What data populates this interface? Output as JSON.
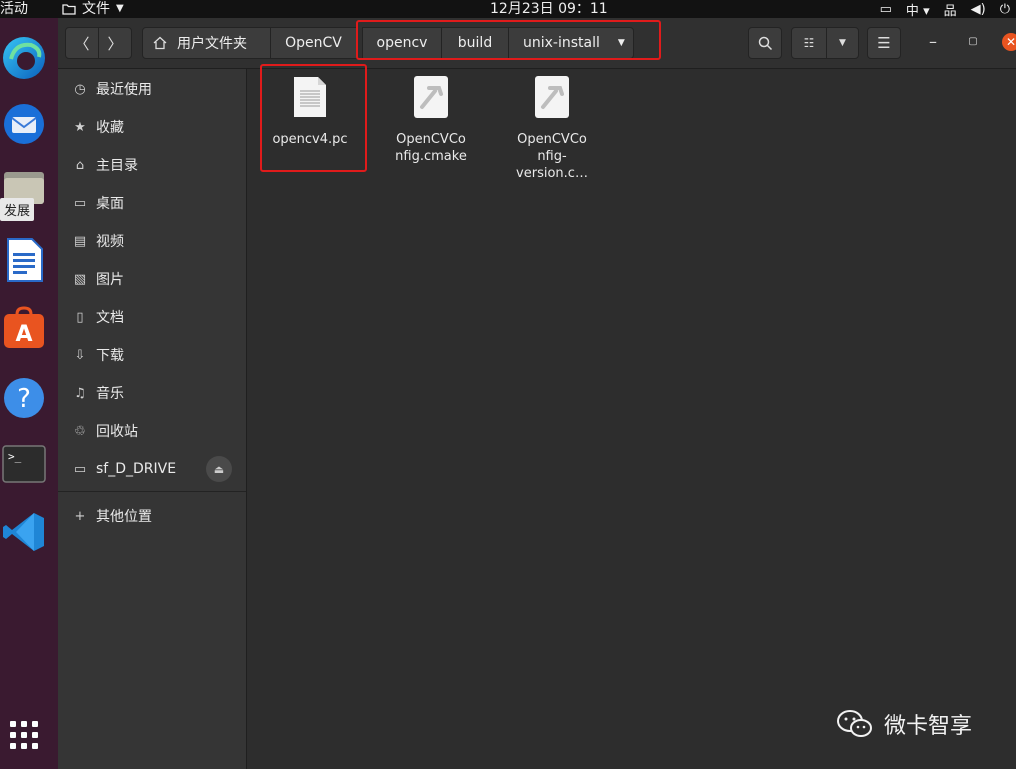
{
  "topbar": {
    "activities": "活动",
    "app_menu": "文件",
    "clock": "12月23日  09：11",
    "input_method": "中"
  },
  "dock": {
    "tooltip": "发展",
    "apps": [
      "edge-icon",
      "thunderbird-icon",
      "files-icon",
      "writer-icon",
      "software-icon",
      "help-icon",
      "terminal-icon",
      "vscode-icon",
      "show-apps-icon"
    ]
  },
  "header": {
    "home_crumb": "用户文件夹",
    "crumbs": [
      "OpenCV",
      "opencv",
      "build",
      "unix-install"
    ]
  },
  "sidebar": {
    "items": [
      {
        "label": "最近使用",
        "icon": "clock-icon"
      },
      {
        "label": "收藏",
        "icon": "star-icon"
      },
      {
        "label": "主目录",
        "icon": "home-icon"
      },
      {
        "label": "桌面",
        "icon": "desktop-icon"
      },
      {
        "label": "视频",
        "icon": "video-icon"
      },
      {
        "label": "图片",
        "icon": "picture-icon"
      },
      {
        "label": "文档",
        "icon": "document-icon"
      },
      {
        "label": "下载",
        "icon": "download-icon"
      },
      {
        "label": "音乐",
        "icon": "music-icon"
      },
      {
        "label": "回收站",
        "icon": "trash-icon"
      }
    ],
    "drive": "sf_D_DRIVE",
    "other": "其他位置"
  },
  "files": [
    {
      "name": "opencv4.pc",
      "icon": "text-file-icon"
    },
    {
      "name": "OpenCVConfig.cmake",
      "display": "OpenCVCo\nnfig.cmake",
      "icon": "cmake-file-icon"
    },
    {
      "name": "OpenCVConfig-version.cmake",
      "display": "OpenCVCo\nnfig-\nversion.c…",
      "icon": "cmake-file-icon"
    }
  ],
  "watermark": "微卡智享"
}
